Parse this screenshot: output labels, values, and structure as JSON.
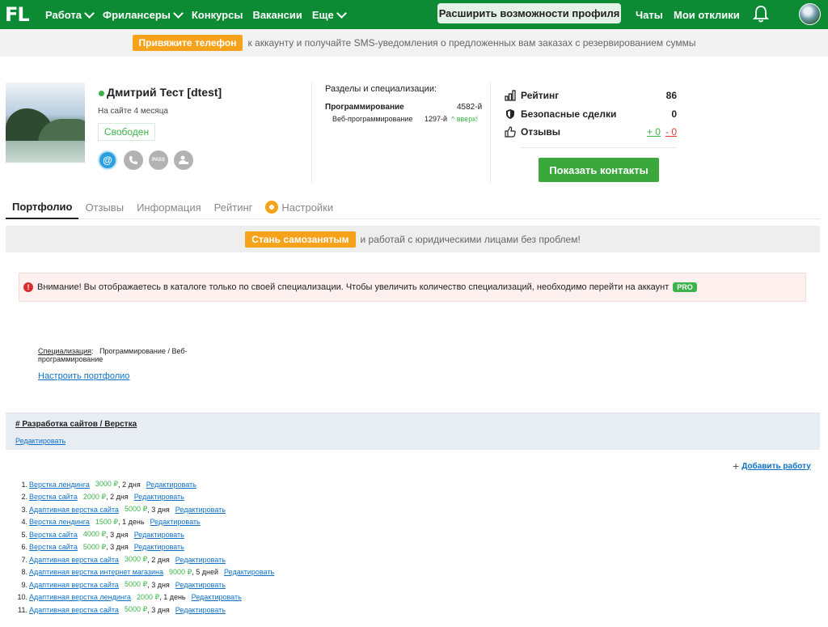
{
  "nav": {
    "logo": "FL",
    "items": [
      {
        "label": "Работа",
        "has_dropdown": true
      },
      {
        "label": "Фрилансеры",
        "has_dropdown": true
      },
      {
        "label": "Конкурсы",
        "has_dropdown": false
      },
      {
        "label": "Вакансии",
        "has_dropdown": false
      },
      {
        "label": "Еще",
        "has_dropdown": true
      }
    ],
    "extend_button": "Расширить возможности профиля",
    "chats": "Чаты",
    "my_responses": "Мои отклики",
    "bg_color": "#0d8a34"
  },
  "sms_banner": {
    "button": "Привяжите телефон",
    "text": "к аккаунту и получайте SMS-уведомления о предложенных вам заказах с резервированием суммы"
  },
  "profile": {
    "name": "Дмитрий Тест [dtest]",
    "on_site": "На сайте 4 месяца",
    "status": "Свободен",
    "verifications": [
      "email-icon",
      "phone-icon",
      "pass-icon",
      "user-check-icon"
    ],
    "pass_label": "PASS",
    "sections_title": "Разделы и специализации:",
    "spec_main": "Программирование",
    "spec_main_rank": "4582-й",
    "spec_sub": "Веб-программирование",
    "spec_sub_rank": "1297-й",
    "spec_sub_trend": "^ вверх!",
    "stats": {
      "rating_label": "Рейтинг",
      "rating_value": "86",
      "safe_deals_label": "Безопасные сделки",
      "safe_deals_value": "0",
      "reviews_label": "Отзывы",
      "reviews_plus": "+ 0",
      "reviews_minus": "- 0"
    },
    "contacts_button": "Показать контакты"
  },
  "tabs": [
    {
      "label": "Портфолио",
      "active": true
    },
    {
      "label": "Отзывы",
      "active": false
    },
    {
      "label": "Информация",
      "active": false
    },
    {
      "label": "Рейтинг",
      "active": false
    },
    {
      "label": "Настройки",
      "active": false
    }
  ],
  "self_banner": {
    "button": "Стань самозанятым",
    "text": "и работай с юридическими лицами без проблем!"
  },
  "warning": {
    "text": "Внимание! Вы отображаетесь в каталоге только по своей специализации. Чтобы увеличить количество специализаций, необходимо перейти на аккаунт",
    "pro": "PRO"
  },
  "portfolio": {
    "spec_label": "Специализация",
    "spec_value": "Программирование / Веб-программирование",
    "setup_link": "Настроить портфолио",
    "category_title": "#  Разработка сайтов / Верстка",
    "category_edit": "Редактировать",
    "add_work": "Добавить работу",
    "edit_label": "Редактировать",
    "works": [
      {
        "n": "1.",
        "title": "Верстка лендинга",
        "price": "3000 ₽",
        "term": ", 2 дня"
      },
      {
        "n": "2.",
        "title": "Верстка сайта",
        "price": "2000 ₽",
        "term": ", 2 дня"
      },
      {
        "n": "3.",
        "title": "Адаптивная верстка сайта",
        "price": "5000 ₽",
        "term": ", 3 дня"
      },
      {
        "n": "4.",
        "title": "Верстка лендинга",
        "price": "1500 ₽",
        "term": ", 1 день"
      },
      {
        "n": "5.",
        "title": "Верстка сайта",
        "price": "4000 ₽",
        "term": ", 3 дня"
      },
      {
        "n": "6.",
        "title": "Верстка сайта",
        "price": "5000 ₽",
        "term": ", 3 дня"
      },
      {
        "n": "7.",
        "title": "Адаптивная верстка сайта",
        "price": "3000 ₽",
        "term": ", 2 дня"
      },
      {
        "n": "8.",
        "title": "Адаптивная верстка интернет магазина",
        "price": "9000 ₽",
        "term": ", 5 дней"
      },
      {
        "n": "9.",
        "title": "Адаптивная верстка сайта",
        "price": "5000 ₽",
        "term": ", 3 дня"
      },
      {
        "n": "10.",
        "title": "Адаптивная верстка лендинга",
        "price": "2000 ₽",
        "term": ", 1 день"
      },
      {
        "n": "11.",
        "title": "Адаптивная верстка сайта",
        "price": "5000 ₽",
        "term": ", 3 дня"
      }
    ]
  }
}
